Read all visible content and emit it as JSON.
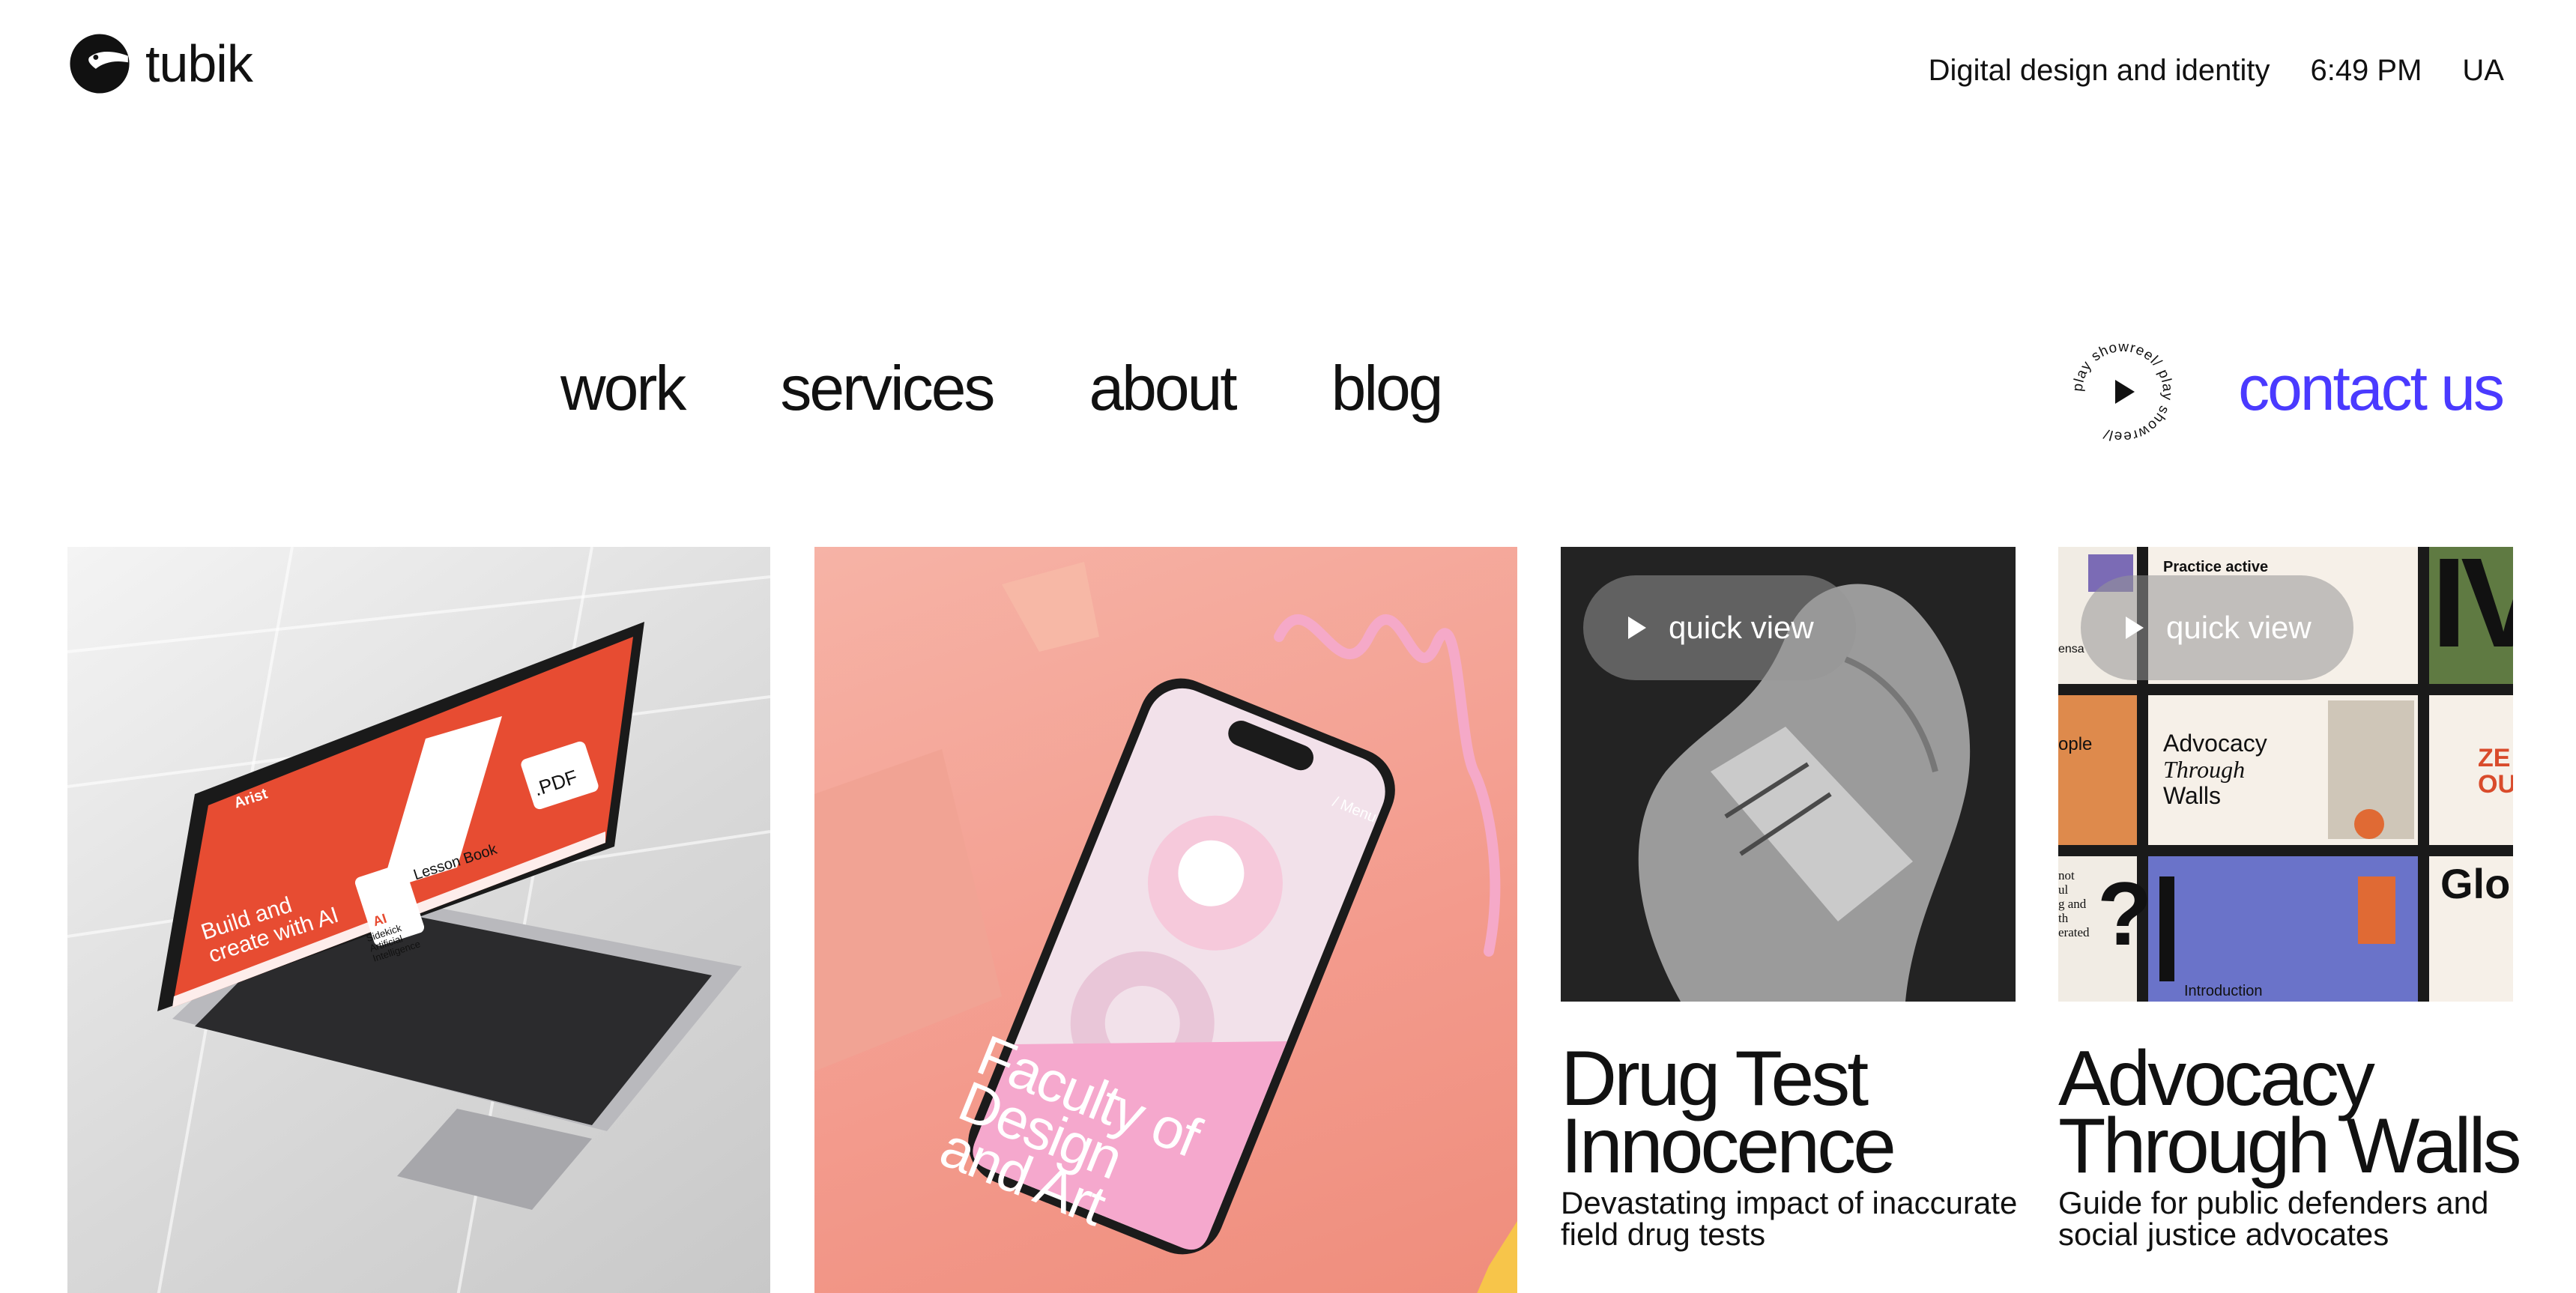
{
  "brand": {
    "name": "tubik"
  },
  "top_bar": {
    "tagline": "Digital design and identity",
    "time": "6:49 PM",
    "locale": "UA"
  },
  "nav": {
    "items": [
      {
        "label": "work"
      },
      {
        "label": "services"
      },
      {
        "label": "about"
      },
      {
        "label": "blog"
      }
    ]
  },
  "showreel": {
    "ring_text": "play showreel/ play showreel/",
    "icon": "play-icon"
  },
  "contact": {
    "label": "contact us",
    "color": "#4a3aff"
  },
  "tiles": [
    {
      "laptop_screen": {
        "brand": "Arist",
        "headline": "Build and create with AI",
        "card_title": "Lesson Book",
        "pdf_label": ".PDF",
        "ai_badge": "AI",
        "ai_text": "Sidekick Artificial Intelligence"
      }
    },
    {
      "phone_screen": {
        "text": "Faculty of Design and Art",
        "menu": "/ Menu"
      }
    },
    {
      "quick_view": "quick view",
      "title": "Drug Test Innocence",
      "subtitle": "Devastating impact of inaccurate field drug tests"
    },
    {
      "quick_view": "quick view",
      "title": "Advocacy Through Walls",
      "subtitle": "Guide for public defenders and social justice advocates",
      "collage": {
        "practice": "Practice active",
        "advocacy_lines": [
          "Advocacy",
          "Through",
          "Walls"
        ],
        "glo": "Glo",
        "intro": "Introduction",
        "people": "ople",
        "fragment_left": "ensa",
        "fragment_col": [
          "not",
          "ul",
          "g and",
          "th",
          "erated"
        ],
        "big_letters": "IV",
        "ze": "ZE",
        "ou": "OU",
        "question": "?"
      }
    }
  ]
}
